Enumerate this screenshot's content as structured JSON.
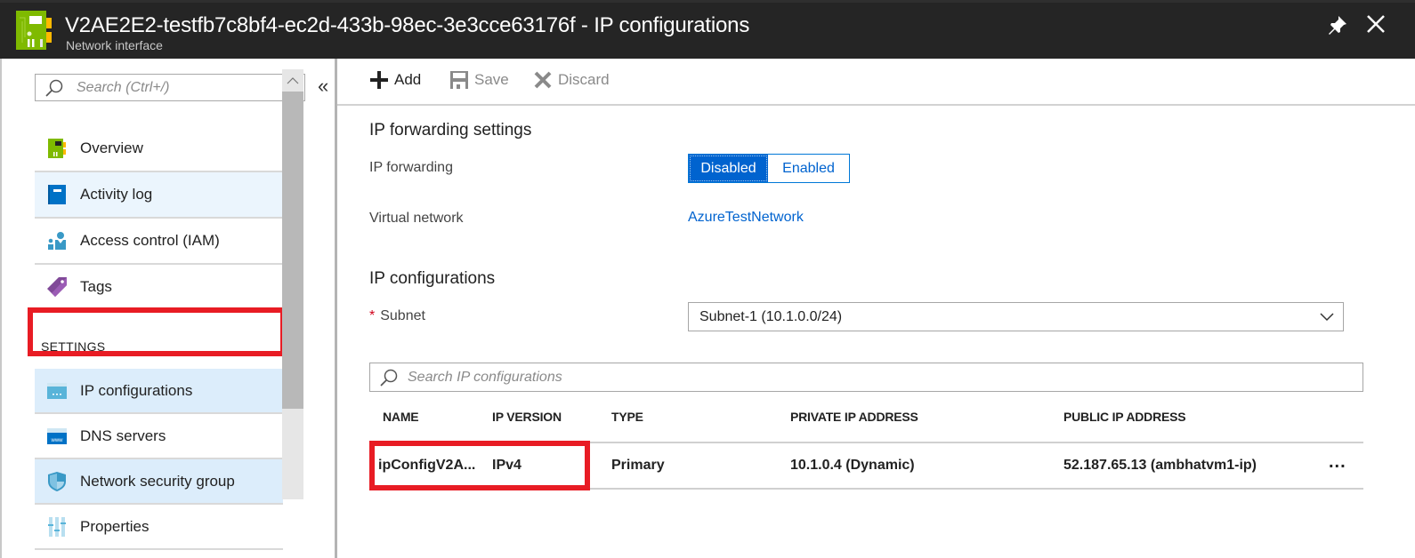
{
  "header": {
    "title": "V2AE2E2-testfb7c8bf4-ec2d-433b-98ec-3e3cce63176f - IP configurations",
    "subtitle": "Network interface",
    "icon": "network-interface-icon",
    "actions": [
      {
        "name": "pin",
        "icon": "pin-icon"
      },
      {
        "name": "close",
        "icon": "close-icon"
      }
    ]
  },
  "sidebar": {
    "search_placeholder": "Search (Ctrl+/)",
    "collapse_label": "«",
    "items": [
      {
        "label": "Overview",
        "icon": "network-interface-icon"
      },
      {
        "label": "Activity log",
        "icon": "activity-log-icon"
      },
      {
        "label": "Access control (IAM)",
        "icon": "access-control-icon"
      },
      {
        "label": "Tags",
        "icon": "tag-icon"
      }
    ],
    "settings_header": "SETTINGS",
    "settings_items": [
      {
        "label": "IP configurations",
        "icon": "ip-configurations-icon",
        "selected": true
      },
      {
        "label": "DNS servers",
        "icon": "dns-servers-icon"
      },
      {
        "label": "Network security group",
        "icon": "shield-icon"
      },
      {
        "label": "Properties",
        "icon": "properties-icon"
      }
    ]
  },
  "toolbar": {
    "add_label": "Add",
    "save_label": "Save",
    "discard_label": "Discard"
  },
  "main": {
    "ip_forwarding_section": "IP forwarding settings",
    "ip_forwarding_label": "IP forwarding",
    "ip_forwarding_options": [
      "Disabled",
      "Enabled"
    ],
    "ip_forwarding_value": "Disabled",
    "virtual_network_label": "Virtual network",
    "virtual_network_value": "AzureTestNetwork",
    "ip_config_section": "IP configurations",
    "subnet_required_mark": "*",
    "subnet_label": "Subnet",
    "subnet_value": "Subnet-1 (10.1.0.0/24)",
    "search_placeholder": "Search IP configurations",
    "table": {
      "columns": [
        "NAME",
        "IP VERSION",
        "TYPE",
        "PRIVATE IP ADDRESS",
        "PUBLIC IP ADDRESS"
      ],
      "rows": [
        {
          "name": "ipConfigV2A...",
          "ip_version": "IPv4",
          "type": "Primary",
          "private_ip": "10.1.0.4 (Dynamic)",
          "public_ip": "52.187.65.13 (ambhatvm1-ip)",
          "more": "..."
        }
      ]
    }
  },
  "colors": {
    "accent": "#0063cf",
    "highlight_box": "#e81c24",
    "titlebar": "#252525"
  }
}
